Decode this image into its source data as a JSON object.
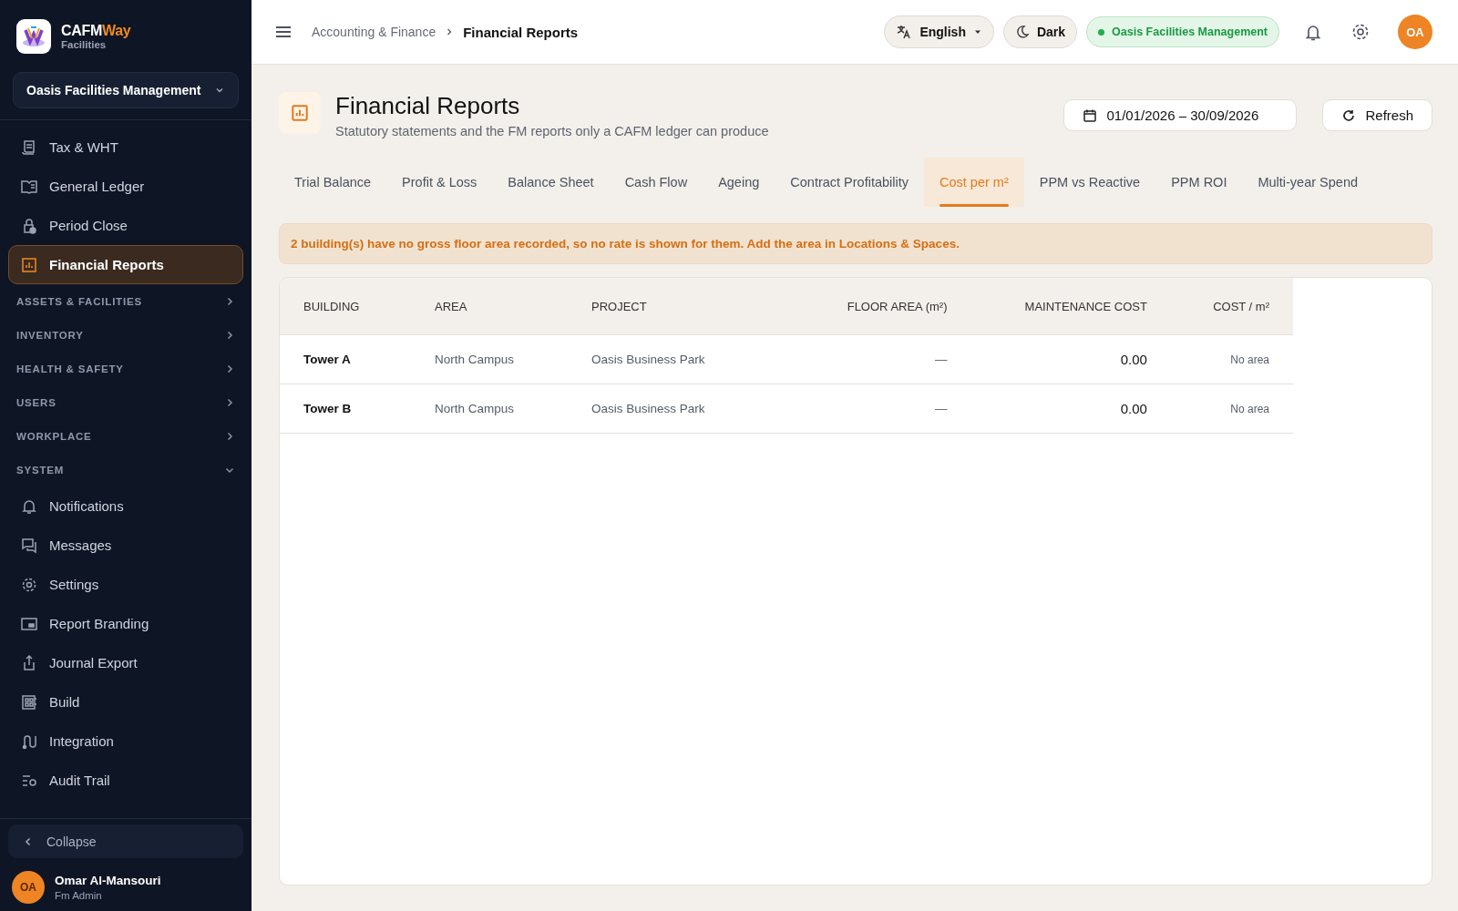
{
  "brand": {
    "name_part1": "CAFM",
    "name_part2": "Way",
    "subtitle": "Facilities"
  },
  "org_selector": {
    "value": "Oasis Facilities Management"
  },
  "sidebar": {
    "items": [
      {
        "kind": "link",
        "label": "Tax & WHT",
        "selected": false
      },
      {
        "kind": "link",
        "label": "General Ledger",
        "selected": false
      },
      {
        "kind": "link",
        "label": "Period Close",
        "selected": false
      },
      {
        "kind": "link",
        "label": "Financial Reports",
        "selected": true
      },
      {
        "kind": "section",
        "label": "ASSETS & FACILITIES",
        "expanded": false
      },
      {
        "kind": "section",
        "label": "INVENTORY",
        "expanded": false
      },
      {
        "kind": "section",
        "label": "HEALTH & SAFETY",
        "expanded": false
      },
      {
        "kind": "section",
        "label": "USERS",
        "expanded": false
      },
      {
        "kind": "section",
        "label": "WORKPLACE",
        "expanded": false
      },
      {
        "kind": "section",
        "label": "SYSTEM",
        "expanded": true
      },
      {
        "kind": "link",
        "label": "Notifications",
        "selected": false
      },
      {
        "kind": "link",
        "label": "Messages",
        "selected": false
      },
      {
        "kind": "link",
        "label": "Settings",
        "selected": false
      },
      {
        "kind": "link",
        "label": "Report Branding",
        "selected": false
      },
      {
        "kind": "link",
        "label": "Journal Export",
        "selected": false
      },
      {
        "kind": "link",
        "label": "Build",
        "selected": false
      },
      {
        "kind": "link",
        "label": "Integration",
        "selected": false
      },
      {
        "kind": "link",
        "label": "Audit Trail",
        "selected": false
      }
    ],
    "collapse": "Collapse",
    "user": {
      "initials": "OA",
      "name": "Omar Al-Mansouri",
      "role": "Fm Admin"
    }
  },
  "header": {
    "breadcrumb": [
      "Accounting & Finance",
      "Financial Reports"
    ],
    "language": "English",
    "theme": "Dark",
    "tenant": "Oasis Facilities Management",
    "avatar": "OA"
  },
  "page": {
    "title": "Financial Reports",
    "subtitle": "Statutory statements and the FM reports only a CAFM ledger can produce",
    "date_range": "01/01/2026 – 30/09/2026",
    "refresh": "Refresh"
  },
  "tabs": [
    {
      "label": "Trial Balance",
      "selected": false
    },
    {
      "label": "Profit & Loss",
      "selected": false
    },
    {
      "label": "Balance Sheet",
      "selected": false
    },
    {
      "label": "Cash Flow",
      "selected": false
    },
    {
      "label": "Ageing",
      "selected": false
    },
    {
      "label": "Contract Profitability",
      "selected": false
    },
    {
      "label": "Cost per m²",
      "selected": true
    },
    {
      "label": "PPM vs Reactive",
      "selected": false
    },
    {
      "label": "PPM ROI",
      "selected": false
    },
    {
      "label": "Multi-year Spend",
      "selected": false
    }
  ],
  "alert": "2 building(s) have no gross floor area recorded, so no rate is shown for them. Add the area in Locations & Spaces.",
  "table": {
    "columns": [
      "BUILDING",
      "AREA",
      "PROJECT",
      "FLOOR AREA (m²)",
      "MAINTENANCE COST",
      "COST / m²"
    ],
    "rows": [
      {
        "building": "Tower A",
        "area": "North Campus",
        "project": "Oasis Business Park",
        "floor_area": "—",
        "maintenance_cost": "0.00",
        "cost_per_m2": "No area"
      },
      {
        "building": "Tower B",
        "area": "North Campus",
        "project": "Oasis Business Park",
        "floor_area": "—",
        "maintenance_cost": "0.00",
        "cost_per_m2": "No area"
      }
    ]
  }
}
